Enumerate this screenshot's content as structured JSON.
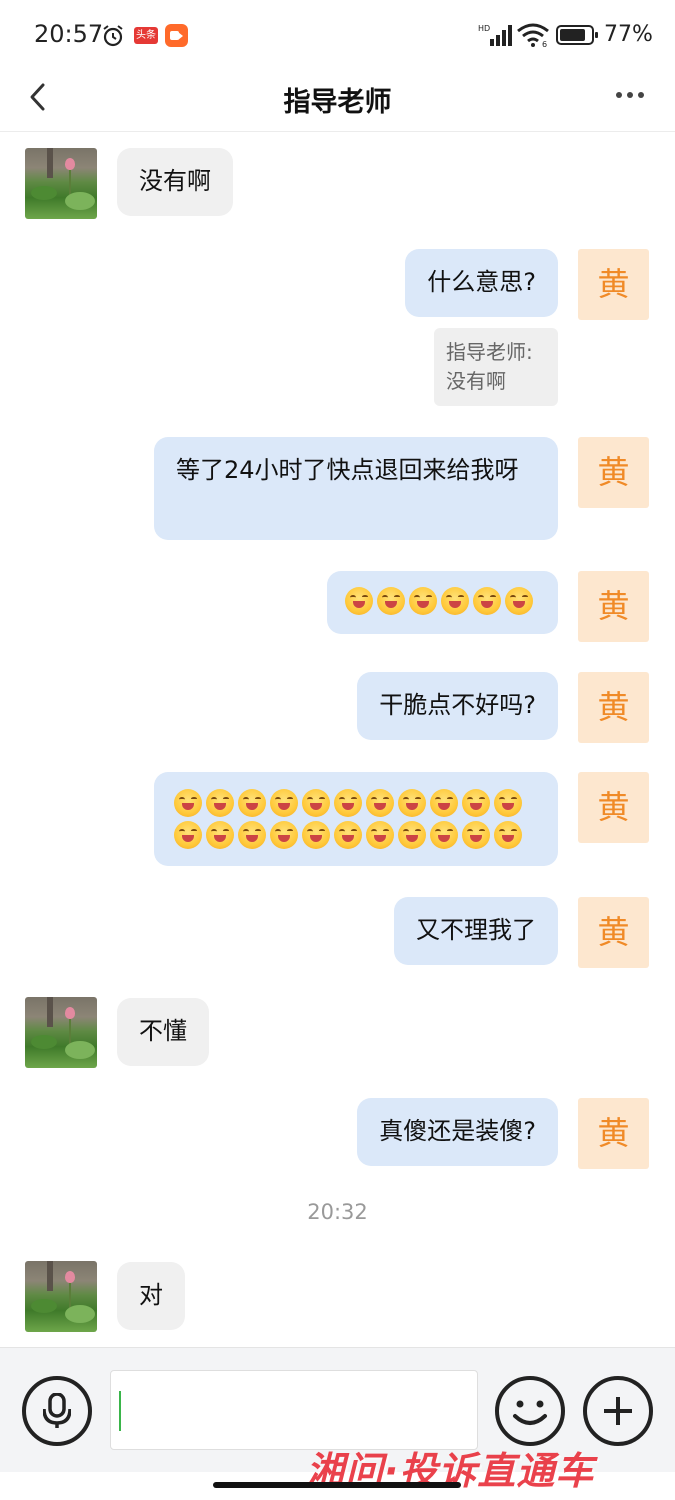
{
  "status_bar": {
    "time": "20:57",
    "battery": "77%",
    "toutiao_label": "头条"
  },
  "header": {
    "title": "指导老师"
  },
  "messages": {
    "m1": "没有啊",
    "m2": "什么意思?",
    "m2_quote_author": "指导老师:",
    "m2_quote_text": "没有啊",
    "m3": "等了24小时了快点退回来给我呀",
    "m5": "干脆点不好吗?",
    "m7": "又不理我了",
    "m8": "不懂",
    "m9": "真傻还是装傻?",
    "timestamp": "20:32",
    "m10": "对"
  },
  "emoji_counts": {
    "m4": 6,
    "m6_row1": 11,
    "m6_row2": 11
  },
  "user_avatar_char": "黄",
  "icons": {
    "back": "back-icon",
    "more": "more-icon",
    "voice": "voice-icon",
    "emoji": "emoji-icon",
    "add": "add-icon"
  },
  "colors": {
    "outgoing_bubble": "#dbe8f9",
    "incoming_bubble": "#f0f0f0",
    "avatar_bg": "#fde7cf",
    "avatar_text": "#f08a27"
  },
  "watermark": "湘问·投诉直通车"
}
